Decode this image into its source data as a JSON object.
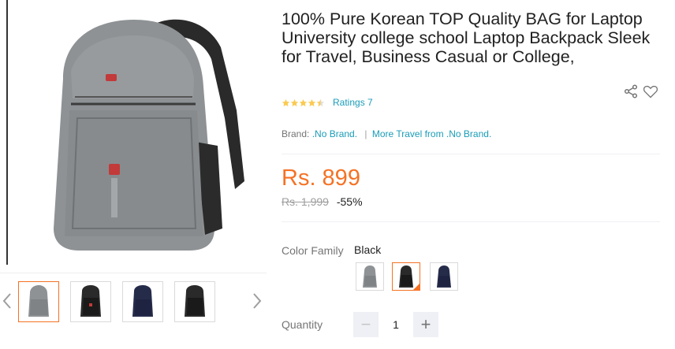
{
  "product": {
    "title": "100% Pure Korean TOP Quality BAG for Laptop University college school Laptop Backpack Sleek for Travel, Business Casual or College,",
    "rating_value": 4.5,
    "ratings_text": "Ratings 7",
    "brand_label": "Brand:",
    "brand_name": ".No Brand.",
    "more_link": "More Travel from .No Brand.",
    "price": "Rs. 899",
    "original_price": "Rs. 1,999",
    "discount": "-55%",
    "color_label": "Color Family",
    "color_value": "Black",
    "quantity_label": "Quantity",
    "quantity_value": "1",
    "minus_symbol": "−",
    "plus_symbol": "+"
  },
  "gallery": {
    "thumbnails": [
      {
        "color": "gray",
        "active": true
      },
      {
        "color": "black",
        "active": false
      },
      {
        "color": "navy",
        "active": false
      },
      {
        "color": "black",
        "active": false
      }
    ]
  },
  "swatches": [
    {
      "color": "gray",
      "selected": false
    },
    {
      "color": "black",
      "selected": true
    },
    {
      "color": "navy",
      "selected": false
    }
  ],
  "icons": {
    "share": "share-icon",
    "wishlist": "heart-icon",
    "prev": "chevron-left-icon",
    "next": "chevron-right-icon"
  },
  "colors": {
    "accent": "#f57224",
    "link": "#1a9cb7",
    "star": "#faca51",
    "bag_gray": "#8e9295",
    "bag_black": "#2a2a2a",
    "bag_navy": "#252c4a"
  }
}
